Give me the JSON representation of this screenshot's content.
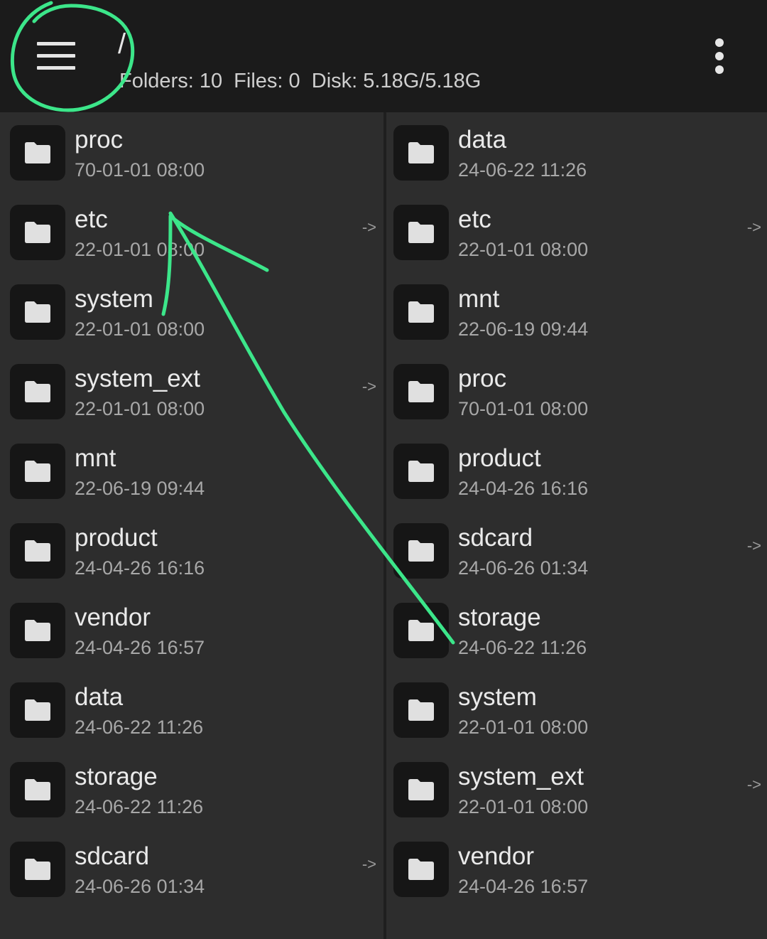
{
  "header": {
    "path": "/",
    "stats": "Folders: 10  Files: 0  Disk: 5.18G/5.18G"
  },
  "icons": {
    "menu": "hamburger-menu-icon",
    "overflow": "more-vertical-icon",
    "folder": "folder-icon"
  },
  "colors": {
    "appbar": "#1b1b1b",
    "background": "#2d2d2d",
    "annotation": "#3ce68a"
  },
  "left_pane": [
    {
      "name": "proc",
      "date": "70-01-01 08:00",
      "link": ""
    },
    {
      "name": "etc",
      "date": "22-01-01 08:00",
      "link": "->"
    },
    {
      "name": "system",
      "date": "22-01-01 08:00",
      "link": ""
    },
    {
      "name": "system_ext",
      "date": "22-01-01 08:00",
      "link": "->"
    },
    {
      "name": "mnt",
      "date": "22-06-19 09:44",
      "link": ""
    },
    {
      "name": "product",
      "date": "24-04-26 16:16",
      "link": ""
    },
    {
      "name": "vendor",
      "date": "24-04-26 16:57",
      "link": ""
    },
    {
      "name": "data",
      "date": "24-06-22 11:26",
      "link": ""
    },
    {
      "name": "storage",
      "date": "24-06-22 11:26",
      "link": ""
    },
    {
      "name": "sdcard",
      "date": "24-06-26 01:34",
      "link": "->"
    }
  ],
  "right_pane": [
    {
      "name": "data",
      "date": "24-06-22 11:26",
      "link": ""
    },
    {
      "name": "etc",
      "date": "22-01-01 08:00",
      "link": "->"
    },
    {
      "name": "mnt",
      "date": "22-06-19 09:44",
      "link": ""
    },
    {
      "name": "proc",
      "date": "70-01-01 08:00",
      "link": ""
    },
    {
      "name": "product",
      "date": "24-04-26 16:16",
      "link": ""
    },
    {
      "name": "sdcard",
      "date": "24-06-26 01:34",
      "link": "->"
    },
    {
      "name": "storage",
      "date": "24-06-22 11:26",
      "link": ""
    },
    {
      "name": "system",
      "date": "22-01-01 08:00",
      "link": ""
    },
    {
      "name": "system_ext",
      "date": "22-01-01 08:00",
      "link": "->"
    },
    {
      "name": "vendor",
      "date": "24-04-26 16:57",
      "link": ""
    }
  ]
}
